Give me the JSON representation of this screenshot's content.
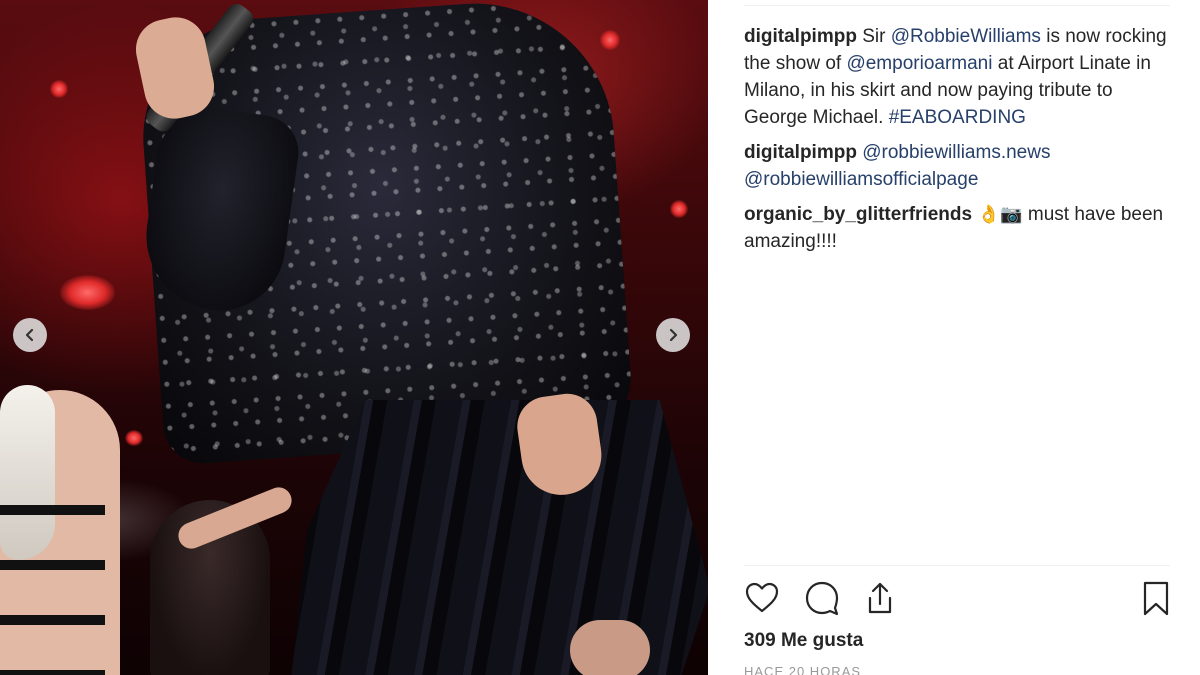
{
  "post": {
    "comments": [
      {
        "username": "digitalpimpp",
        "parts": [
          {
            "type": "text",
            "text": " Sir "
          },
          {
            "type": "mention",
            "text": "@RobbieWilliams"
          },
          {
            "type": "text",
            "text": " is now rocking the show of "
          },
          {
            "type": "mention",
            "text": "@emporioarmani"
          },
          {
            "type": "text",
            "text": " at Airport Linate in Milano, in his skirt and now paying tribute to George Michael. "
          },
          {
            "type": "tag",
            "text": "#EABOARDING"
          }
        ]
      },
      {
        "username": "digitalpimpp",
        "parts": [
          {
            "type": "text",
            "text": " "
          },
          {
            "type": "mention",
            "text": "@robbiewilliams.news"
          },
          {
            "type": "text",
            "text": " "
          },
          {
            "type": "mention",
            "text": "@robbiewilliamsofficialpage"
          }
        ]
      },
      {
        "username": "organic_by_glitterfriends",
        "parts": [
          {
            "type": "emoji",
            "text": " 👌📷"
          },
          {
            "type": "text",
            "text": " must have been amazing!!!!"
          }
        ]
      }
    ],
    "likes_text": "309 Me gusta",
    "time_text": "HACE 20 HORAS"
  },
  "icons": {
    "like": "heart-icon",
    "comment": "comment-bubble-icon",
    "share": "share-icon",
    "save": "bookmark-icon",
    "prev": "chevron-left-icon",
    "next": "chevron-right-icon"
  },
  "colors": {
    "text": "#262626",
    "mention": "#27406b",
    "muted": "#999999",
    "divider": "#efefef"
  }
}
